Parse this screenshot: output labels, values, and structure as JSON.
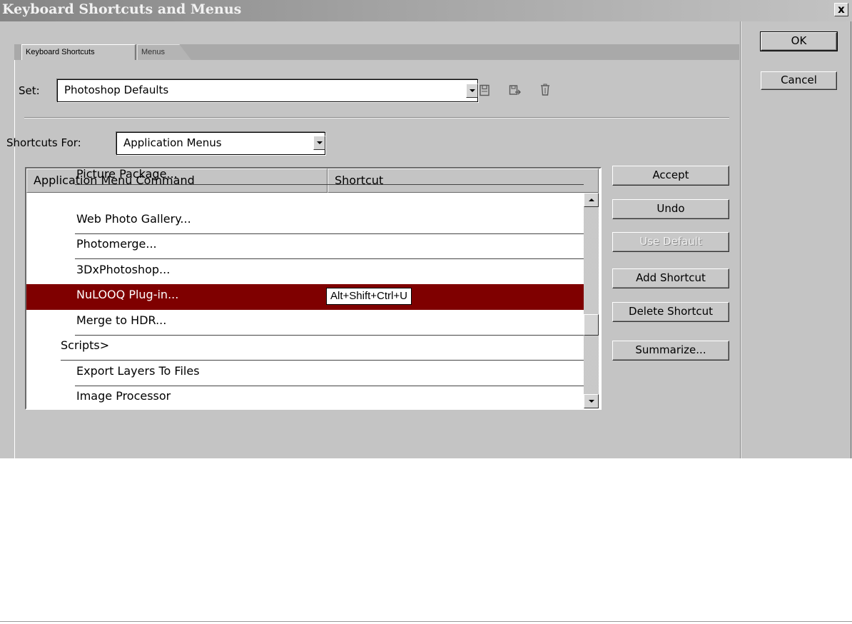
{
  "window": {
    "title": "Keyboard Shortcuts and Menus",
    "close_label": "x"
  },
  "dialog_buttons": {
    "ok": "OK",
    "cancel": "Cancel"
  },
  "tabs": [
    {
      "label": "Keyboard Shortcuts",
      "active": true
    },
    {
      "label": "Menus",
      "active": false
    }
  ],
  "set": {
    "label": "Set:",
    "value": "Photoshop Defaults"
  },
  "shortcuts_for": {
    "label": "Shortcuts For:",
    "value": "Application Menus"
  },
  "columns": {
    "command": "Application Menu Command",
    "shortcut": "Shortcut"
  },
  "rows": [
    {
      "label": "Picture Package...",
      "shortcut": "",
      "selected": false
    },
    {
      "label": "Web Photo Gallery...",
      "shortcut": "",
      "selected": false
    },
    {
      "label": "Photomerge...",
      "shortcut": "",
      "selected": false
    },
    {
      "label": "3DxPhotoshop...",
      "shortcut": "",
      "selected": false
    },
    {
      "label": "NuLOOQ Plug-in...",
      "shortcut": "Alt+Shift+Ctrl+U",
      "selected": true
    },
    {
      "label": "Merge to HDR...",
      "shortcut": "",
      "selected": false
    },
    {
      "label": "Scripts>",
      "shortcut": "",
      "selected": false
    },
    {
      "label": "Export Layers To Files",
      "shortcut": "",
      "selected": false
    },
    {
      "label": "Image Processor",
      "shortcut": "",
      "selected": false
    }
  ],
  "side_buttons": {
    "accept": "Accept",
    "undo": "Undo",
    "use_default": "Use Default",
    "add_shortcut": "Add Shortcut",
    "delete_shortcut": "Delete Shortcut",
    "summarize": "Summarize..."
  },
  "colors": {
    "selection": "#7f0000",
    "dialog_bg": "#c4c4c4"
  },
  "icons": [
    "save-set-icon",
    "save-set-as-icon",
    "delete-set-icon"
  ]
}
